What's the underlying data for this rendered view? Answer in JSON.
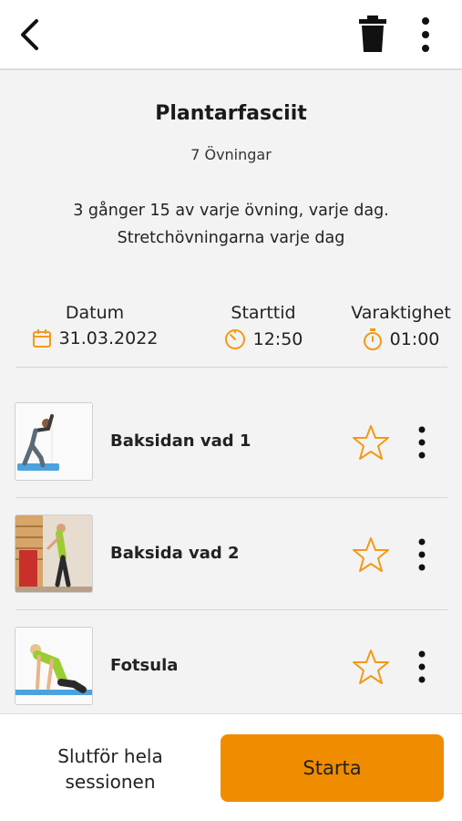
{
  "header": {
    "back_icon": "chevron-left-icon",
    "delete_icon": "trash-icon",
    "more_icon": "more-vertical-icon"
  },
  "program": {
    "title": "Plantarfasciit",
    "exercise_count": "7 Övningar",
    "description_line1": "3 gånger 15 av varje övning, varje dag.",
    "description_line2": "Stretchövningarna varje dag"
  },
  "info": {
    "date_label": "Datum",
    "date_value": "31.03.2022",
    "start_label": "Starttid",
    "start_value": "12:50",
    "duration_label": "Varaktighet",
    "duration_value": "01:00"
  },
  "exercises": [
    {
      "name": "Baksidan vad 1",
      "favorite": false
    },
    {
      "name": "Baksida vad 2",
      "favorite": false
    },
    {
      "name": "Fotsula",
      "favorite": false
    }
  ],
  "footer": {
    "finish_line1": "Slutför hela",
    "finish_line2": "sessionen",
    "start_label": "Starta"
  },
  "colors": {
    "accent": "#f08c00",
    "icon_accent": "#f29a16"
  }
}
